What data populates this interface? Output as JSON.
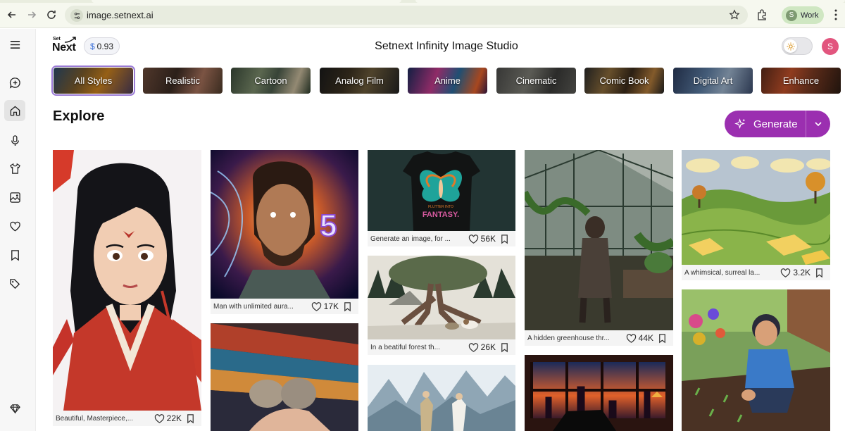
{
  "browser": {
    "url": "image.setnext.ai",
    "profile_initial": "S",
    "profile_label": "Work"
  },
  "sidebar": {
    "items": [
      {
        "icon": "menu-icon"
      },
      {
        "icon": "chat-plus-icon"
      },
      {
        "icon": "home-icon"
      },
      {
        "icon": "microphone-icon"
      },
      {
        "icon": "tshirt-icon"
      },
      {
        "icon": "gallery-icon"
      },
      {
        "icon": "heart-icon"
      },
      {
        "icon": "bookmark-icon"
      },
      {
        "icon": "tags-icon"
      },
      {
        "icon": "diamond-icon"
      }
    ]
  },
  "header": {
    "logo_top": "Set",
    "logo_main": "Next",
    "credits_symbol": "$",
    "credits_value": "0.93",
    "title": "Setnext Infinity Image Studio",
    "user_initial": "S"
  },
  "styles": [
    {
      "label": "All Styles",
      "selected": true
    },
    {
      "label": "Realistic",
      "selected": false
    },
    {
      "label": "Cartoon",
      "selected": false
    },
    {
      "label": "Analog Film",
      "selected": false
    },
    {
      "label": "Anime",
      "selected": false
    },
    {
      "label": "Cinematic",
      "selected": false
    },
    {
      "label": "Comic Book",
      "selected": false
    },
    {
      "label": "Digital Art",
      "selected": false
    },
    {
      "label": "Enhance",
      "selected": false
    }
  ],
  "section_title": "Explore",
  "generate_label": "Generate",
  "cards": [
    {
      "caption": "Beautiful, Masterpiece,...",
      "likes": "22K"
    },
    {
      "caption": "Man with unlimited aura...",
      "likes": "17K"
    },
    {
      "caption": "",
      "likes": ""
    },
    {
      "caption": "Generate an image, for ...",
      "likes": "56K",
      "shirt_text_1": "FLUTTER INTO",
      "shirt_text_2": "FANTASY."
    },
    {
      "caption": "In a beatiful forest th...",
      "likes": "26K"
    },
    {
      "caption": "",
      "likes": ""
    },
    {
      "caption": "A hidden greenhouse thr...",
      "likes": "44K"
    },
    {
      "caption": "",
      "likes": ""
    },
    {
      "caption": "A whimsical, surreal la...",
      "likes": "3.2K"
    },
    {
      "caption": "",
      "likes": ""
    }
  ],
  "colors": {
    "accent": "#9b2fb0",
    "selected_outline": "#9b7bd6",
    "user_avatar": "#e2557e",
    "profile_chip": "#cfe7c2"
  }
}
